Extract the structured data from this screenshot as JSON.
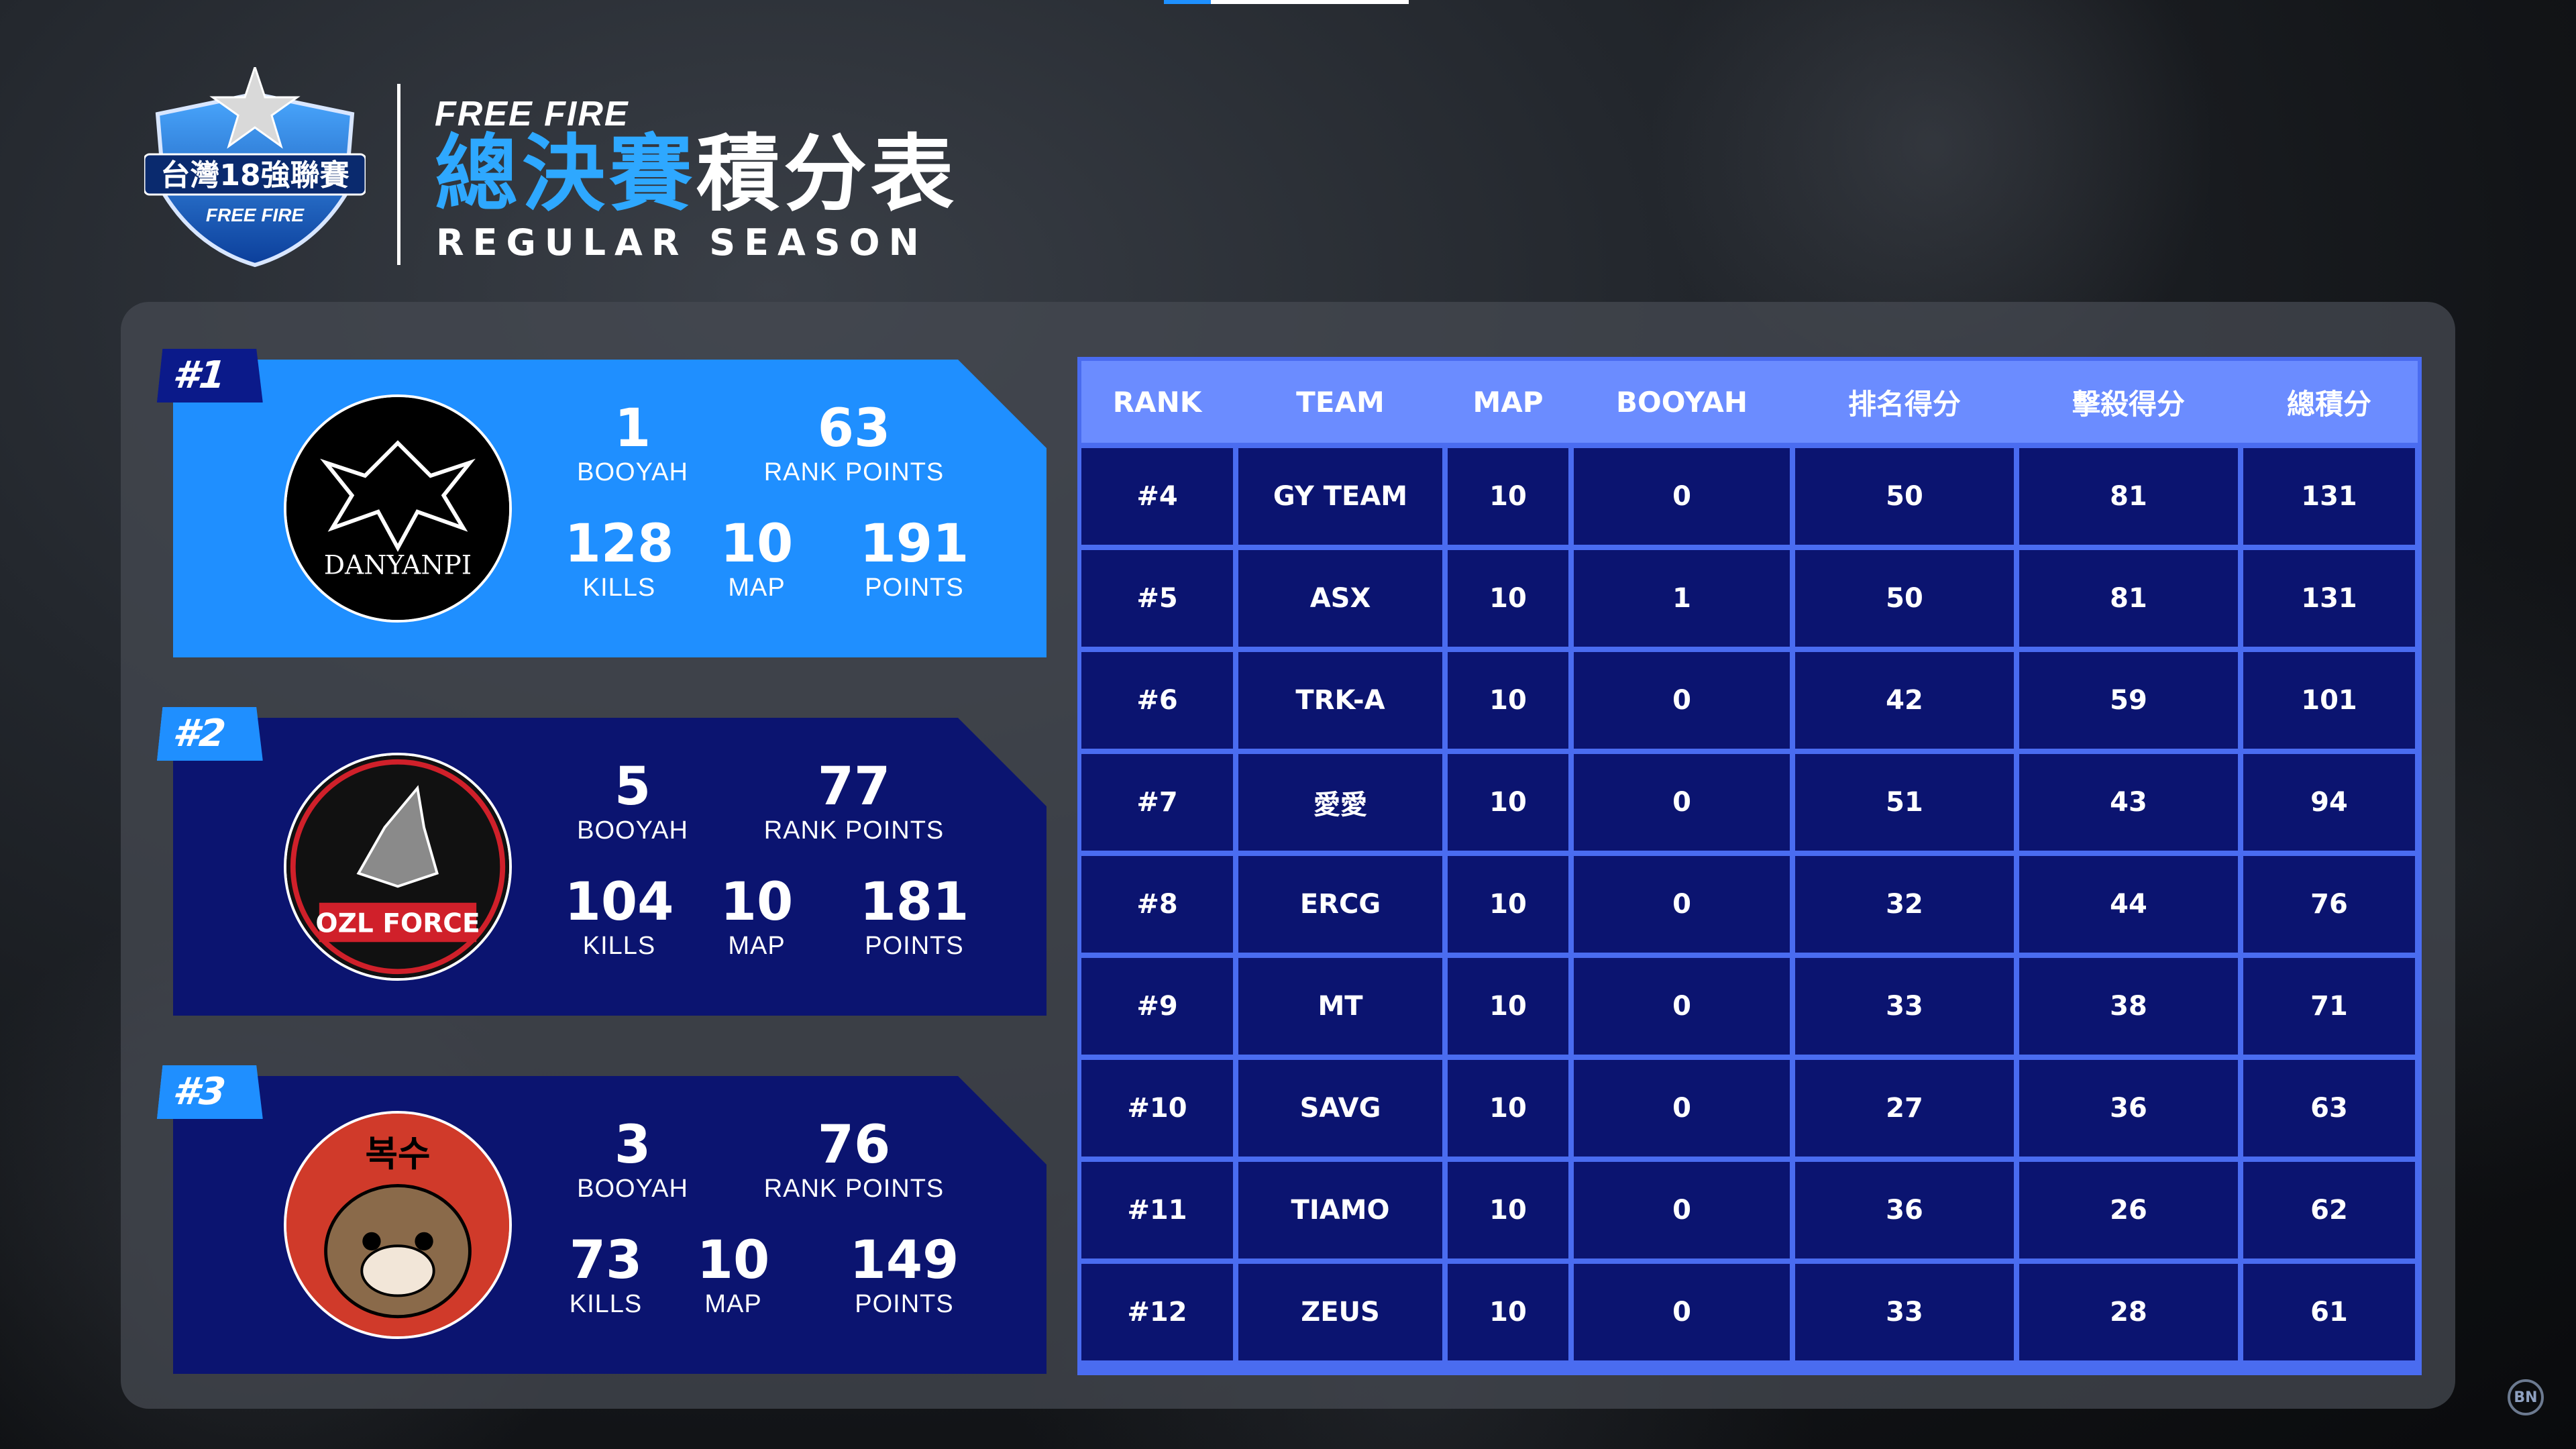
{
  "header": {
    "brand": "FREE FIRE",
    "title_blue": "總決賽",
    "title_white": "積分表",
    "subtitle": "REGULAR SEASON",
    "league_logo_text": "台灣18強聯賽"
  },
  "colors": {
    "accent_blue": "#1f8fff",
    "title_blue": "#2ea8ff",
    "card_navy": "#0b1470",
    "table_header": "#6b8cff",
    "table_border": "#4a6cf0"
  },
  "top3": [
    {
      "rank_label": "#1",
      "team_logo_text": "DANYANPI",
      "booyah": "1",
      "booyah_label": "BOOYAH",
      "rank_points": "63",
      "rank_points_label": "RANK POINTS",
      "kills": "128",
      "kills_label": "KILLS",
      "map": "10",
      "map_label": "MAP",
      "points": "191",
      "points_label": "POINTS"
    },
    {
      "rank_label": "#2",
      "team_logo_text": "OZL FORCE",
      "booyah": "5",
      "booyah_label": "BOOYAH",
      "rank_points": "77",
      "rank_points_label": "RANK POINTS",
      "kills": "104",
      "kills_label": "KILLS",
      "map": "10",
      "map_label": "MAP",
      "points": "181",
      "points_label": "POINTS"
    },
    {
      "rank_label": "#3",
      "team_logo_text": "복수",
      "booyah": "3",
      "booyah_label": "BOOYAH",
      "rank_points": "76",
      "rank_points_label": "RANK POINTS",
      "kills": "73",
      "kills_label": "KILLS",
      "map": "10",
      "map_label": "MAP",
      "points": "149",
      "points_label": "POINTS"
    }
  ],
  "table": {
    "headers": [
      "RANK",
      "TEAM",
      "MAP",
      "BOOYAH",
      "排名得分",
      "擊殺得分",
      "總積分"
    ],
    "rows": [
      [
        "#4",
        "GY TEAM",
        "10",
        "0",
        "50",
        "81",
        "131"
      ],
      [
        "#5",
        "ASX",
        "10",
        "1",
        "50",
        "81",
        "131"
      ],
      [
        "#6",
        "TRK-A",
        "10",
        "0",
        "42",
        "59",
        "101"
      ],
      [
        "#7",
        "愛愛",
        "10",
        "0",
        "51",
        "43",
        "94"
      ],
      [
        "#8",
        "ERCG",
        "10",
        "0",
        "32",
        "44",
        "76"
      ],
      [
        "#9",
        "MT",
        "10",
        "0",
        "33",
        "38",
        "71"
      ],
      [
        "#10",
        "SAVG",
        "10",
        "0",
        "27",
        "36",
        "63"
      ],
      [
        "#11",
        "TIAMO",
        "10",
        "0",
        "36",
        "26",
        "62"
      ],
      [
        "#12",
        "ZEUS",
        "10",
        "0",
        "33",
        "28",
        "61"
      ]
    ]
  },
  "corner_mark": "BN"
}
